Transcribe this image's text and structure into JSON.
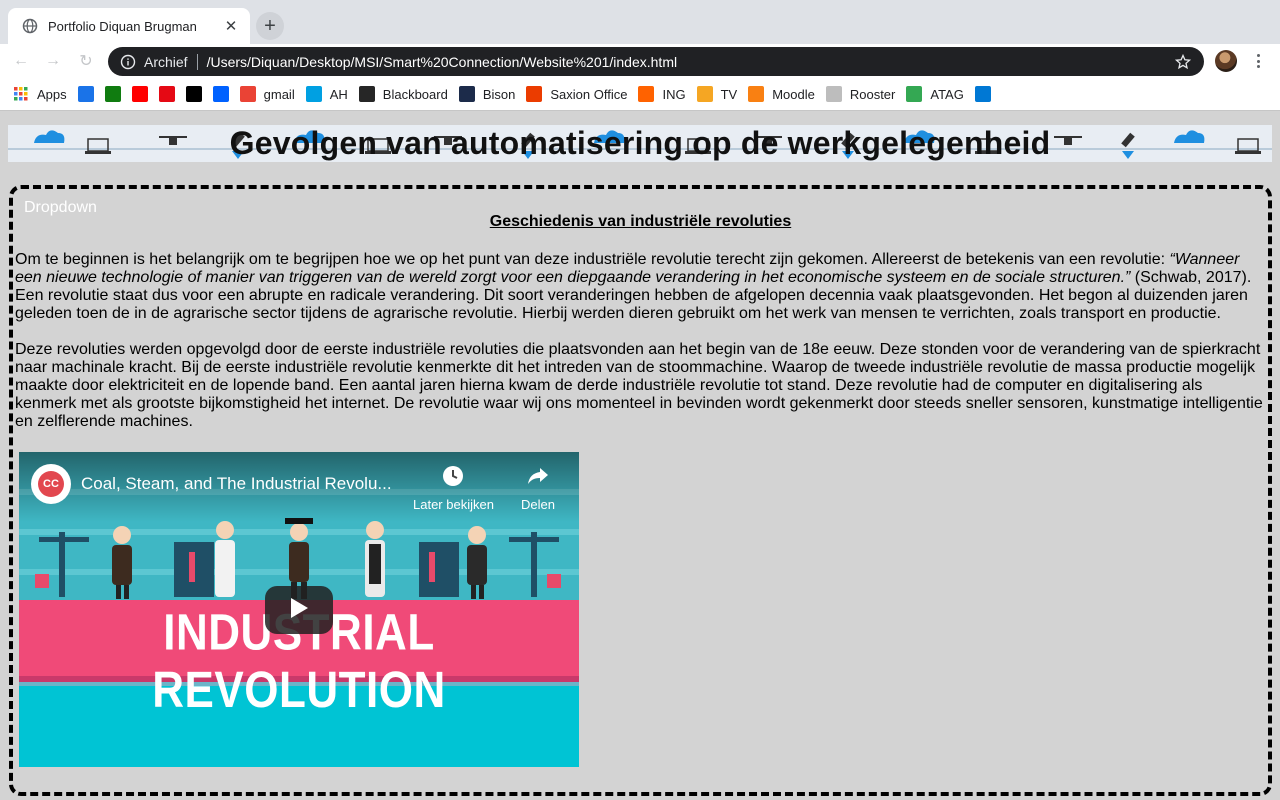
{
  "browser": {
    "tab": {
      "title": "Portfolio Diquan Brugman",
      "favicon": "globe-icon"
    },
    "omnibox": {
      "chip": "Archief",
      "url": "/Users/Diquan/Desktop/MSI/Smart%20Connection/Website%201/index.html"
    },
    "bookmarks": [
      {
        "label": "Apps",
        "icon": "apps-grid-icon",
        "color": "#4285f4"
      },
      {
        "label": "",
        "icon": "blue-diamond-icon",
        "color": "#1a73e8"
      },
      {
        "label": "",
        "icon": "xbox-icon",
        "color": "#107c10"
      },
      {
        "label": "",
        "icon": "youtube-icon",
        "color": "#ff0000"
      },
      {
        "label": "",
        "icon": "netflix-icon",
        "color": "#e50914"
      },
      {
        "label": "",
        "icon": "v-icon",
        "color": "#000000"
      },
      {
        "label": "",
        "icon": "dropbox-icon",
        "color": "#0061ff"
      },
      {
        "label": "gmail",
        "icon": "gmail-icon",
        "color": "#ea4335"
      },
      {
        "label": "AH",
        "icon": "ah-icon",
        "color": "#00a0e2"
      },
      {
        "label": "Blackboard",
        "icon": "blackboard-icon",
        "color": "#262626"
      },
      {
        "label": "Bison",
        "icon": "bison-icon",
        "color": "#1c2b4a"
      },
      {
        "label": "Saxion Office",
        "icon": "office-icon",
        "color": "#eb3c00"
      },
      {
        "label": "ING",
        "icon": "ing-icon",
        "color": "#ff6200"
      },
      {
        "label": "TV",
        "icon": "tv-icon",
        "color": "#f5a623"
      },
      {
        "label": "Moodle",
        "icon": "moodle-icon",
        "color": "#f98012"
      },
      {
        "label": "Rooster",
        "icon": "rooster-icon",
        "color": "#bdbdbd"
      },
      {
        "label": "ATAG",
        "icon": "google-drive-icon",
        "color": "#34a853"
      },
      {
        "label": "",
        "icon": "outlook-icon",
        "color": "#0078d4"
      }
    ]
  },
  "page": {
    "banner_title": "Gevolgen van automatisering op de werkgelegenheid",
    "dropdown_label": "Dropdown",
    "section_title": "Geschiedenis van industriële revoluties",
    "p1_before": "Om te beginnen is het belangrijk om te begrijpen hoe we op het punt van deze industriële revolutie terecht zijn gekomen. Allereerst de betekenis van een revolutie: ",
    "p1_quote": "“Wanneer een nieuwe technologie of manier van triggeren van de wereld zorgt voor een diepgaande verandering in het economische systeem en de sociale structuren.”",
    "p1_after": " (Schwab, 2017). Een revolutie staat dus voor een abrupte en radicale verandering. Dit soort veranderingen hebben de afgelopen decennia vaak plaatsgevonden. Het begon al duizenden jaren geleden toen de in de agrarische sector tijdens de agrarische revolutie. Hierbij werden dieren gebruikt om het werk van mensen te verrichten, zoals transport en productie.",
    "p2": "Deze revoluties werden opgevolgd door de eerste industriële revoluties die plaatsvonden aan het begin van de 18e eeuw. Deze stonden voor de verandering van de spierkracht naar machinale kracht. Bij de eerste industriële revolutie kenmerkte dit het intreden van de stoommachine. Waarop de tweede industriële revolutie de massa productie mogelijk maakte door elektriciteit en de lopende band. Een aantal jaren hierna kwam de derde industriële revolutie tot stand. Deze revolutie had de computer en digitalisering als kenmerk met als grootste bijkomstigheid het internet. De revolutie waar wij ons momenteel in bevinden wordt gekenmerkt door steeds sneller sensoren, kunstmatige intelligentie en zelflerende machines."
  },
  "video": {
    "channel_badge": "CC",
    "title": "Coal, Steam, and The Industrial Revolu...",
    "watch_later": "Later bekijken",
    "share": "Delen",
    "thumbnail_text": "INDUSTRIAL REVOLUTION"
  }
}
